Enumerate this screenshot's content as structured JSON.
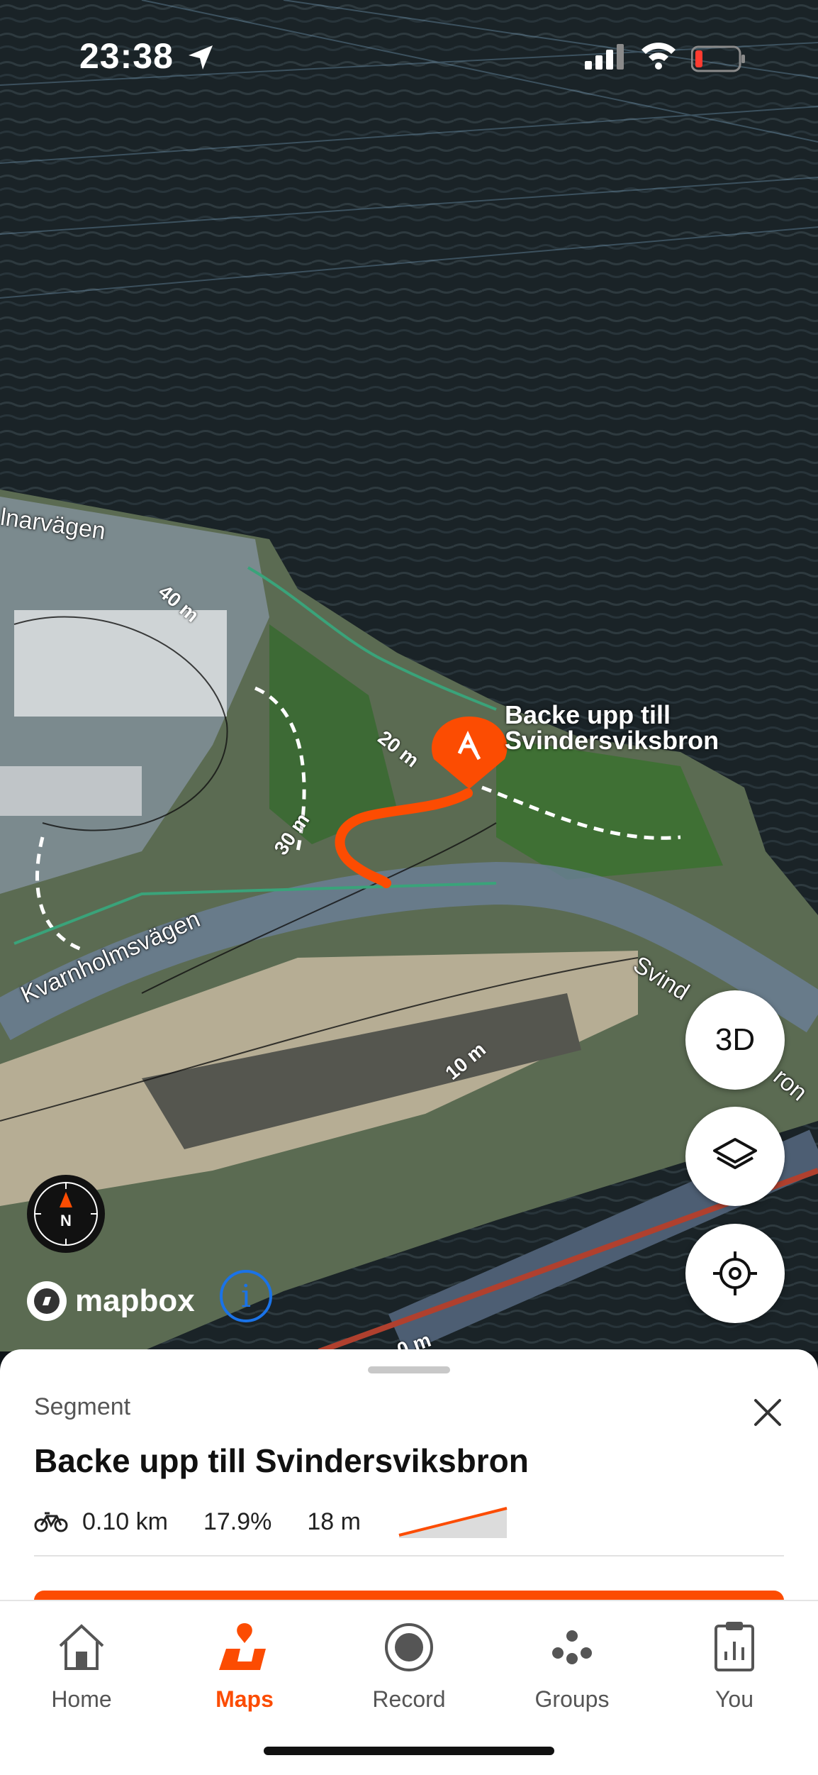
{
  "status_bar": {
    "time": "23:38"
  },
  "map": {
    "street_labels": [
      "lnarvägen",
      "Kvarnholmsvägen",
      "Svind",
      "ron"
    ],
    "contour_labels": [
      "40 m",
      "20 m",
      "30 m",
      "10 m",
      "0 m"
    ],
    "segment_marker_label_line1": "Backe upp till",
    "segment_marker_label_line2": "Svindersviksbron",
    "btn_3d": "3D",
    "attribution": "mapbox",
    "compass_letter": "N",
    "info_icon_glyph": "i"
  },
  "sheet": {
    "kicker": "Segment",
    "title": "Backe upp till Svindersviksbron",
    "activity_icon": "bike-icon",
    "distance": "0.10 km",
    "grade": "17.9%",
    "elevation": "18 m"
  },
  "tabs": [
    {
      "label": "Home",
      "icon": "home-icon"
    },
    {
      "label": "Maps",
      "icon": "maps-icon"
    },
    {
      "label": "Record",
      "icon": "record-icon"
    },
    {
      "label": "Groups",
      "icon": "groups-icon"
    },
    {
      "label": "You",
      "icon": "you-icon"
    }
  ],
  "colors": {
    "accent": "#fc4c02",
    "info_blue": "#1a73e8"
  }
}
